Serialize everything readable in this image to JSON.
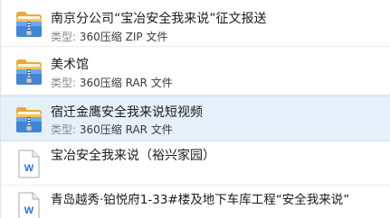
{
  "colors": {
    "selected_bg": "#e5f0fb",
    "meta_label": "#8a8a8a",
    "text": "#1b1b1b",
    "word_blue": "#2b6fd6"
  },
  "files": [
    {
      "name": "南京分公司“宝冶安全我来说”征文报送",
      "type_label": "类型:",
      "type_value": "360压缩 ZIP 文件",
      "icon": "archive-icon",
      "selected": false
    },
    {
      "name": "美术馆",
      "type_label": "类型:",
      "type_value": "360压缩 RAR 文件",
      "icon": "archive-icon",
      "selected": false
    },
    {
      "name": "宿迁金鹰安全我来说短视频",
      "type_label": "类型:",
      "type_value": "360压缩 RAR 文件",
      "icon": "archive-icon",
      "selected": true
    },
    {
      "name": "宝冶安全我来说（裕兴家园）",
      "icon": "word-document-icon",
      "icon_letter": "W",
      "selected": false
    },
    {
      "name": "青岛越秀·铂悦府1-33#楼及地下车库工程“安全我来说”",
      "icon": "word-document-icon",
      "icon_letter": "W",
      "selected": false
    }
  ]
}
